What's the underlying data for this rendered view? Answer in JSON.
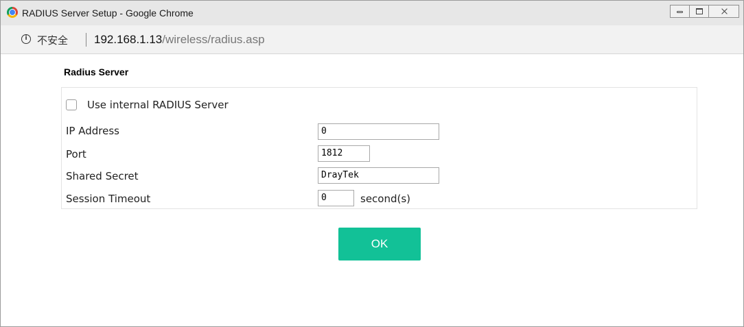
{
  "window": {
    "title": "RADIUS Server Setup - Google Chrome"
  },
  "addressbar": {
    "security_label": "不安全",
    "url_host": "192.168.1.13",
    "url_path": "/wireless/radius.asp"
  },
  "form": {
    "section_title": "Radius Server",
    "use_internal": {
      "label": "Use internal RADIUS Server",
      "checked": false
    },
    "ip_address": {
      "label": "IP Address",
      "value": "0"
    },
    "port": {
      "label": "Port",
      "value": "1812"
    },
    "shared_secret": {
      "label": "Shared Secret",
      "value": "DrayTek"
    },
    "session_timeout": {
      "label": "Session Timeout",
      "value": "0",
      "unit": "second(s)"
    },
    "ok_label": "OK"
  },
  "icons": {
    "browser": "chrome-icon",
    "info": "info-icon",
    "minimize": "minimize-icon",
    "maximize": "maximize-icon",
    "close": "close-icon"
  },
  "colors": {
    "ok_button": "#12c197",
    "titlebar": "#e7e7e7",
    "addressbar": "#f2f2f2"
  }
}
